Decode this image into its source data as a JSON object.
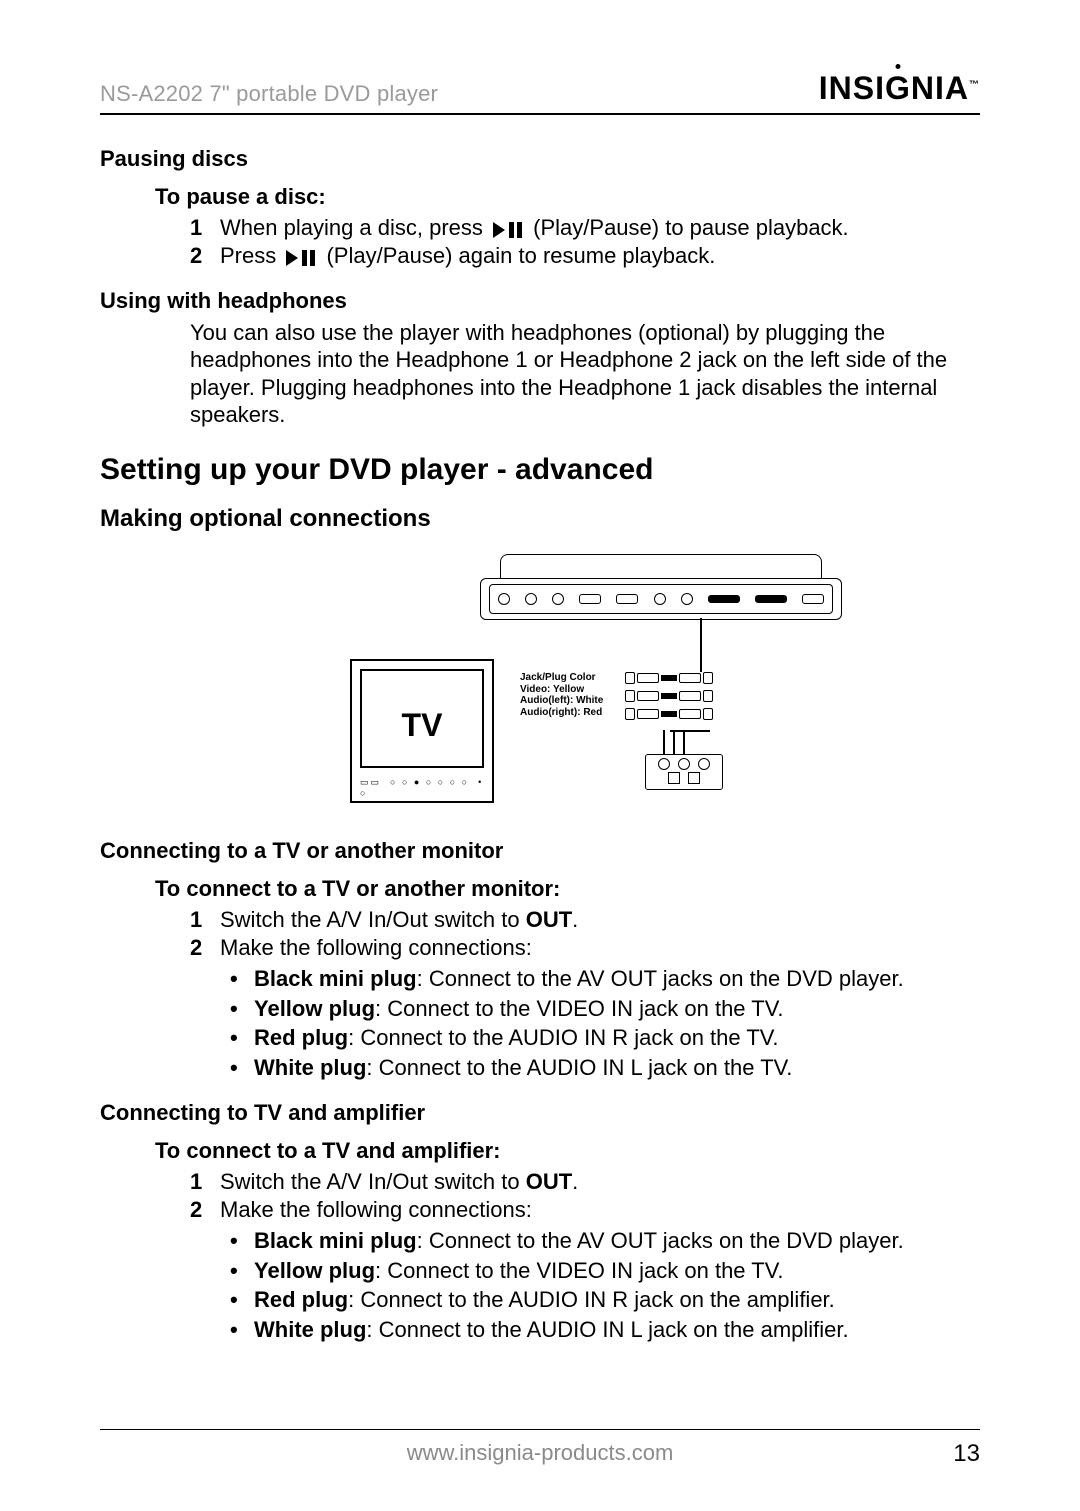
{
  "header": {
    "doc_title": "NS-A2202 7\" portable DVD player",
    "brand": "INSIGNIA"
  },
  "section_pausing": {
    "title": "Pausing discs",
    "subtitle": "To pause a disc:",
    "step1_a": "When playing a disc, press ",
    "step1_b": " (Play/Pause) to pause playback.",
    "step2_a": "Press ",
    "step2_b": " (Play/Pause) again to resume playback."
  },
  "section_headphones": {
    "title": "Using with headphones",
    "para": "You can also use the player with headphones (optional) by plugging the headphones into the Headphone 1 or Headphone 2 jack on the left side of the player. Plugging headphones into the Headphone 1 jack disables the internal speakers."
  },
  "h2_setup": "Setting up your DVD player - advanced",
  "h_optional": "Making optional connections",
  "diagram": {
    "tv_label": "TV",
    "jack_label_title": "Jack/Plug Color",
    "jack_video": "Video: Yellow",
    "jack_audio_l": "Audio(left): White",
    "jack_audio_r_a": "Audio(right): ",
    "jack_audio_r_b": "Red"
  },
  "section_tv": {
    "title": "Connecting to a TV or another monitor",
    "subtitle": "To connect to a TV or another monitor:",
    "step1_a": "Switch the A/V In/Out switch to ",
    "step1_b": "OUT",
    "step1_c": ".",
    "step2": "Make the following connections:",
    "bullets": [
      {
        "strong": "Black mini plug",
        "rest": ": Connect to the AV OUT jacks on the DVD player."
      },
      {
        "strong": "Yellow plug",
        "rest": ": Connect to the VIDEO IN jack on the TV."
      },
      {
        "strong": "Red plug",
        "rest": ": Connect to the AUDIO IN R jack on the TV."
      },
      {
        "strong": "White plug",
        "rest": ": Connect to the AUDIO IN L jack on the TV."
      }
    ]
  },
  "section_amp": {
    "title": "Connecting to TV and amplifier",
    "subtitle": "To connect to a TV and amplifier:",
    "step1_a": "Switch the A/V In/Out switch to ",
    "step1_b": "OUT",
    "step1_c": ".",
    "step2": "Make the following connections:",
    "bullets": [
      {
        "strong": "Black mini plug",
        "rest": ": Connect to the AV OUT jacks on the DVD player."
      },
      {
        "strong": "Yellow plug",
        "rest": ": Connect to the VIDEO IN jack on the TV."
      },
      {
        "strong": "Red plug",
        "rest": ": Connect to the AUDIO IN R jack on the amplifier."
      },
      {
        "strong": "White plug",
        "rest": ": Connect to the AUDIO IN L jack on the amplifier."
      }
    ]
  },
  "footer": {
    "url": "www.insignia-products.com",
    "page": "13"
  }
}
